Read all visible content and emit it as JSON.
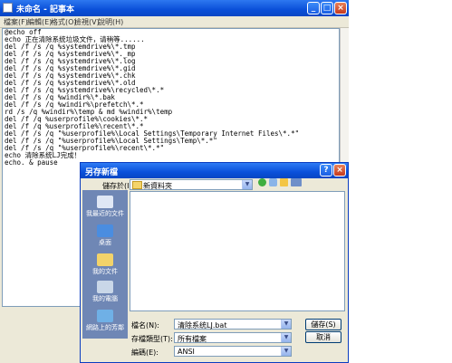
{
  "notepad": {
    "title": "未命名 - 記事本",
    "menu": [
      "檔案(F)",
      "編輯(E)",
      "格式(O)",
      "檢視(V)",
      "說明(H)"
    ],
    "lines": [
      "@echo off",
      "echo 正在清除系统垃圾文件，请稍等......",
      "del /f /s /q %systemdrive%\\*.tmp",
      "del /f /s /q %systemdrive%\\*._mp",
      "del /f /s /q %systemdrive%\\*.log",
      "del /f /s /q %systemdrive%\\*.gid",
      "del /f /s /q %systemdrive%\\*.chk",
      "del /f /s /q %systemdrive%\\*.old",
      "del /f /s /q %systemdrive%\\recycled\\*.*",
      "del /f /s /q %windir%\\*.bak",
      "del /f /s /q %windir%\\prefetch\\*.*",
      "rd /s /q %windir%\\temp & md %windir%\\temp",
      "del /f /q %userprofile%\\cookies\\*.*",
      "del /f /q %userprofile%\\recent\\*.*",
      "del /f /s /q \"%userprofile%\\Local Settings\\Temporary Internet Files\\*.*\"",
      "del /f /s /q \"%userprofile%\\Local Settings\\Temp\\*.*\"",
      "del /f /s /q \"%userprofile%\\recent\\*.*\"",
      "echo 清除系统LJ完成！",
      "echo. & pause"
    ]
  },
  "dialog": {
    "title": "另存新檔",
    "save_in_label": "儲存於(I):",
    "save_in_value": "新資料夾",
    "places": [
      "我最近的文件",
      "桌面",
      "我的文件",
      "我的電腦",
      "網路上的芳鄰"
    ],
    "filename_label": "檔名(N):",
    "filename_value": "清除系统LJ.bat",
    "filetype_label": "存檔類型(T):",
    "filetype_value": "所有檔案",
    "encoding_label": "編碼(E):",
    "encoding_value": "ANSI",
    "save_button": "儲存(S)",
    "cancel_button": "取消"
  }
}
